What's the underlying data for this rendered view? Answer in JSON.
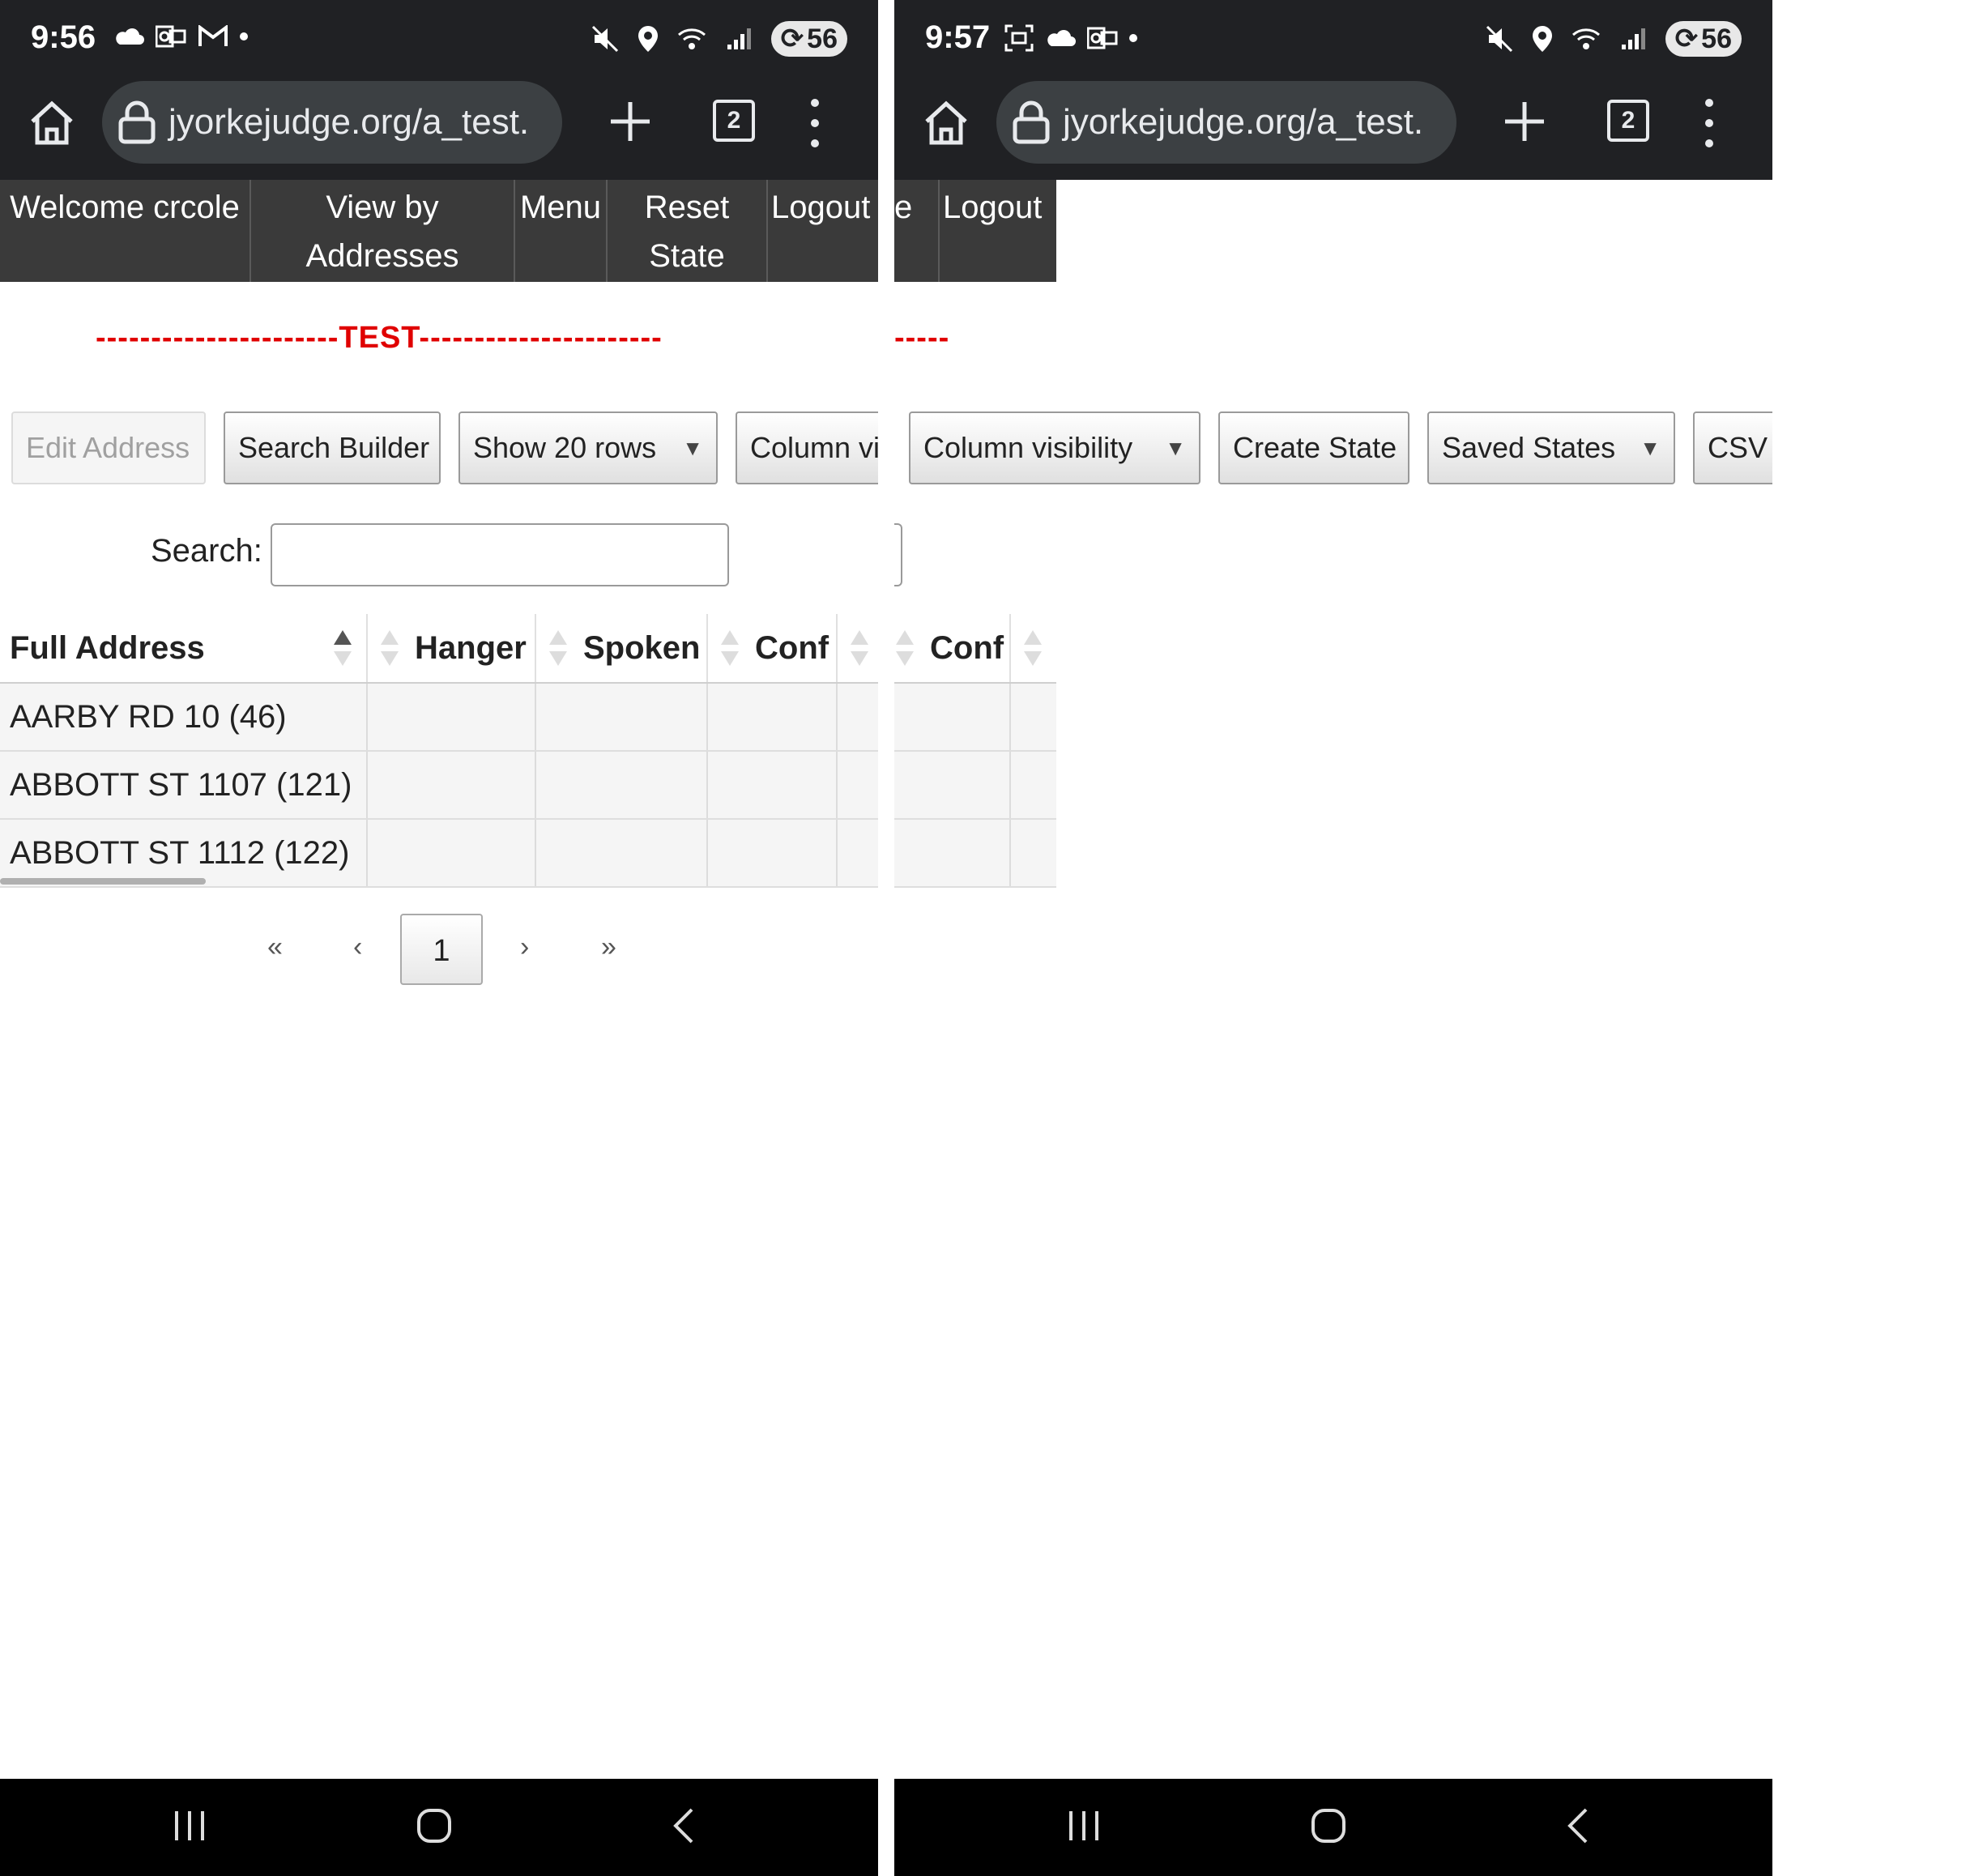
{
  "screens": [
    {
      "status": {
        "time": "9:56",
        "battery": "56"
      },
      "browser": {
        "url": "jyorkejudge.org/a_test.",
        "tab_count": "2"
      },
      "nav": {
        "welcome": "Welcome crcole",
        "view_by_addresses": "View by Addresses",
        "menu": "Menu",
        "reset_state": "Reset State",
        "logout": "Logout",
        "cut_fragment": "t"
      },
      "banner": "----------------------TEST----------------------",
      "buttons": {
        "edit_address": "Edit Address",
        "search_builder": "Search Builder",
        "show_rows": "Show 20 rows",
        "column_visibility": "Column vi"
      },
      "search": {
        "label": "Search:",
        "value": ""
      },
      "table": {
        "columns": [
          "Full Address",
          "Hanger",
          "Spoken",
          "Conf"
        ],
        "rows": [
          [
            "AARBY RD 10 (46)",
            "",
            "",
            ""
          ],
          [
            "ABBOTT ST 1107 (121)",
            "",
            "",
            ""
          ],
          [
            "ABBOTT ST 1112 (122)",
            "",
            "",
            ""
          ]
        ]
      },
      "pager": {
        "first": "«",
        "prev": "‹",
        "current": "1",
        "next": "›",
        "last": "»"
      }
    },
    {
      "status": {
        "time": "9:57",
        "battery": "56"
      },
      "browser": {
        "url": "jyorkejudge.org/a_test.",
        "tab_count": "2"
      },
      "nav": {
        "logout": "Logout",
        "cut_fragment": "e"
      },
      "banner": "-----",
      "buttons": {
        "column_visibility": "Column visibility",
        "create_state": "Create State",
        "saved_states": "Saved States",
        "csv": "CSV"
      },
      "table": {
        "columns": [
          "Conf"
        ]
      }
    }
  ],
  "caret": "▼",
  "colors": {
    "chrome_bg": "#202124",
    "omnibox_bg": "#3c4043",
    "sitenav_bg": "#3a3a3a",
    "banner_red": "#e00000"
  }
}
